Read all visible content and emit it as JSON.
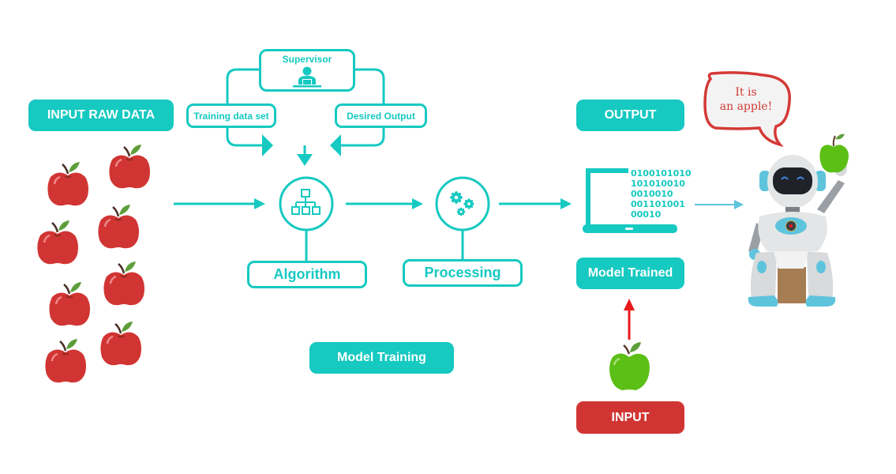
{
  "labels": {
    "input_raw_data": "INPUT RAW DATA",
    "supervisor": "Supervisor",
    "training_data_set": "Training data set",
    "desired_output": "Desired Output",
    "algorithm": "Algorithm",
    "processing": "Processing",
    "model_training": "Model Training",
    "output": "OUTPUT",
    "model_trained": "Model Trained",
    "input": "INPUT",
    "speech": [
      "It is",
      "an apple!"
    ]
  },
  "binary_lines": [
    "0100101010",
    "101010010",
    "0010010",
    "001101001",
    "00010"
  ],
  "icons": {
    "supervisor": "person-at-laptop-icon",
    "algorithm": "hierarchy-icon",
    "processing": "gears-icon",
    "output": "laptop-icon"
  },
  "colors": {
    "teal": "#16c9c1",
    "red": "#d13533",
    "arrow_red": "#e8191b",
    "apple_red": "#d33a36",
    "apple_green": "#5cbf16"
  },
  "raw_apple_count": 8
}
